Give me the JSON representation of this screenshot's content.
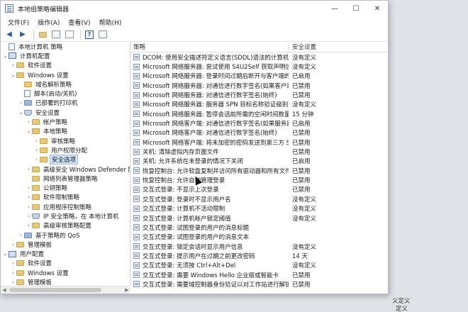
{
  "window": {
    "title": "本地组策略编辑器",
    "minimize_glyph": "—",
    "maximize_glyph": "☐",
    "close_glyph": "✕"
  },
  "menu": [
    "文件(F)",
    "操作(A)",
    "查看(V)",
    "帮助(H)"
  ],
  "toolbar": {
    "icons": [
      "back-arrow-icon",
      "forward-arrow-icon",
      "up-folder-icon",
      "show-hide-tree-icon",
      "properties-icon",
      "help-icon",
      "view-icon"
    ],
    "back": "◀",
    "forward": "▶",
    "help": "?"
  },
  "tree": [
    {
      "level": 0,
      "twisty": "",
      "icon": "doc",
      "label": "本地计算机 策略"
    },
    {
      "level": 0,
      "twisty": "⌄",
      "icon": "pc",
      "label": "计算机配置"
    },
    {
      "level": 1,
      "twisty": "›",
      "icon": "folder",
      "label": "软件设置"
    },
    {
      "level": 1,
      "twisty": "⌄",
      "icon": "folder",
      "label": "Windows 设置"
    },
    {
      "level": 2,
      "twisty": "",
      "icon": "folder",
      "label": "域名解析策略"
    },
    {
      "level": 2,
      "twisty": "",
      "icon": "doc",
      "label": "脚本(启动/关机)"
    },
    {
      "level": 2,
      "twisty": "›",
      "icon": "blue",
      "label": "已部署的打印机"
    },
    {
      "level": 2,
      "twisty": "⌄",
      "icon": "shield",
      "label": "安全设置"
    },
    {
      "level": 3,
      "twisty": "›",
      "icon": "folder",
      "label": "帐户策略"
    },
    {
      "level": 3,
      "twisty": "⌄",
      "icon": "folder",
      "label": "本地策略"
    },
    {
      "level": 4,
      "twisty": "›",
      "icon": "folder",
      "label": "审核策略"
    },
    {
      "level": 4,
      "twisty": "›",
      "icon": "folder",
      "label": "用户权限分配"
    },
    {
      "level": 4,
      "twisty": "›",
      "icon": "folder",
      "label": "安全选项",
      "selected": true
    },
    {
      "level": 3,
      "twisty": "›",
      "icon": "folder",
      "label": "高级安全 Windows Defender 防"
    },
    {
      "level": 3,
      "twisty": "",
      "icon": "folder",
      "label": "网络列表管理器策略"
    },
    {
      "level": 3,
      "twisty": "›",
      "icon": "folder",
      "label": "公钥策略"
    },
    {
      "level": 3,
      "twisty": "›",
      "icon": "folder",
      "label": "软件限制策略"
    },
    {
      "level": 3,
      "twisty": "›",
      "icon": "folder",
      "label": "应用程序控制策略"
    },
    {
      "level": 3,
      "twisty": "›",
      "icon": "shield",
      "label": "IP 安全策略，在 本地计算机"
    },
    {
      "level": 3,
      "twisty": "›",
      "icon": "folder",
      "label": "高级审核策略配置"
    },
    {
      "level": 2,
      "twisty": "›",
      "icon": "blue",
      "label": "基于策略的 QoS"
    },
    {
      "level": 1,
      "twisty": "›",
      "icon": "folder",
      "label": "管理模板"
    },
    {
      "level": 0,
      "twisty": "⌄",
      "icon": "pc",
      "label": "用户配置"
    },
    {
      "level": 1,
      "twisty": "›",
      "icon": "folder",
      "label": "软件设置"
    },
    {
      "level": 1,
      "twisty": "›",
      "icon": "folder",
      "label": "Windows 设置"
    },
    {
      "level": 1,
      "twisty": "›",
      "icon": "folder",
      "label": "管理模板"
    }
  ],
  "list": {
    "columns": [
      "策略",
      "安全设置"
    ],
    "rows": [
      {
        "policy": "DCOM: 使用安全描述符定义语言(SDDL)语法的计算机启动...",
        "setting": "没有定义"
      },
      {
        "policy": "Microsoft 网络服务器: 尝试使用 S4U2Self 获取声明信息",
        "setting": "没有定义"
      },
      {
        "policy": "Microsoft 网络服务器: 登录时间过期后断开与客户端的连接",
        "setting": "已启用"
      },
      {
        "policy": "Microsoft 网络服务器: 对通信进行数字签名(如果客户端允...",
        "setting": "已禁用"
      },
      {
        "policy": "Microsoft 网络服务器: 对通信进行数字签名(始终)",
        "setting": "已禁用"
      },
      {
        "policy": "Microsoft 网络服务器: 服务器 SPN 目标名称验证级别",
        "setting": "没有定义"
      },
      {
        "policy": "Microsoft 网络服务器: 暂停会话前所需的空闲时间数量",
        "setting": "15 分钟"
      },
      {
        "policy": "Microsoft 网络客户端: 对通信进行数字签名(如果服务器允...",
        "setting": "已启用"
      },
      {
        "policy": "Microsoft 网络客户端: 对通信进行数字签名(始终)",
        "setting": "已禁用"
      },
      {
        "policy": "Microsoft 网络客户端: 将未加密的密码发送到第三方 SMB...",
        "setting": "已禁用"
      },
      {
        "policy": "关机: 清除虚拟内存页面文件",
        "setting": "已禁用"
      },
      {
        "policy": "关机: 允许系统在未登录的情况下关闭",
        "setting": "已启用"
      },
      {
        "policy": "恢复控制台: 允许软盘复制并访问所有驱动器和所有文件夹",
        "setting": "已禁用"
      },
      {
        "policy": "恢复控制台: 允许自动管理登录",
        "setting": "已禁用"
      },
      {
        "policy": "交互式登录: 不显示上次登录",
        "setting": "已禁用"
      },
      {
        "policy": "交互式登录: 登录时不显示用户名",
        "setting": "没有定义"
      },
      {
        "policy": "交互式登录: 计算机不活动限制",
        "setting": "没有定义"
      },
      {
        "policy": "交互式登录: 计算机帐户锁定阈值",
        "setting": "没有定义"
      },
      {
        "policy": "交互式登录: 试图登录的用户的消息标题",
        "setting": ""
      },
      {
        "policy": "交互式登录: 试图登录的用户的消息文本",
        "setting": ""
      },
      {
        "policy": "交互式登录: 锁定会话时显示用户信息",
        "setting": "没有定义"
      },
      {
        "policy": "交互式登录: 提示用户在过期之前更改密码",
        "setting": "14 天"
      },
      {
        "policy": "交互式登录: 无须按 Ctrl+Alt+Del",
        "setting": "没有定义"
      },
      {
        "policy": "交互式登录: 需要 Windows Hello 企业版或智能卡",
        "setting": "已禁用"
      },
      {
        "policy": "交互式登录: 需要域控制器身份验证以对工作站进行解锁",
        "setting": "已禁用"
      }
    ]
  },
  "background_text": {
    "right_1": "义定义",
    "right_2": "定义"
  }
}
